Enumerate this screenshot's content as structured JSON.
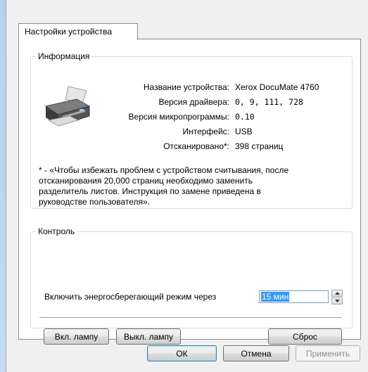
{
  "tab": {
    "label": "Настройки устройства"
  },
  "info": {
    "title": "Информация",
    "rows": [
      {
        "label": "Название устройства:",
        "value": "Xerox DocuMate 4760"
      },
      {
        "label": "Версия драйвера:",
        "value": "0, 9, 111, 728"
      },
      {
        "label": "Версия микропрограммы:",
        "value": "0.10"
      },
      {
        "label": "Интерфейс:",
        "value": "USB"
      },
      {
        "label": "Отсканировано*:",
        "value": "398 страниц"
      }
    ],
    "note": "* - «Чтобы избежать проблем с устройством считывания, после\nотсканирования 20,000 страниц необходимо заменить\nразделитель листов. Инструкция по замене приведена в\nруководстве пользователя»."
  },
  "control": {
    "title": "Контроль",
    "power_save_label": "Включить энергосберегающий режим через",
    "power_save_value": "15 мин",
    "lamp_on": "Вкл. лампу",
    "lamp_off": "Выкл. лампу",
    "reset": "Сброс"
  },
  "footer": {
    "ok": "ОК",
    "cancel": "Отмена",
    "apply": "Применить"
  },
  "icons": {
    "device": "scanner-icon",
    "spin_up": "arrow-up-icon",
    "spin_down": "arrow-down-icon"
  }
}
